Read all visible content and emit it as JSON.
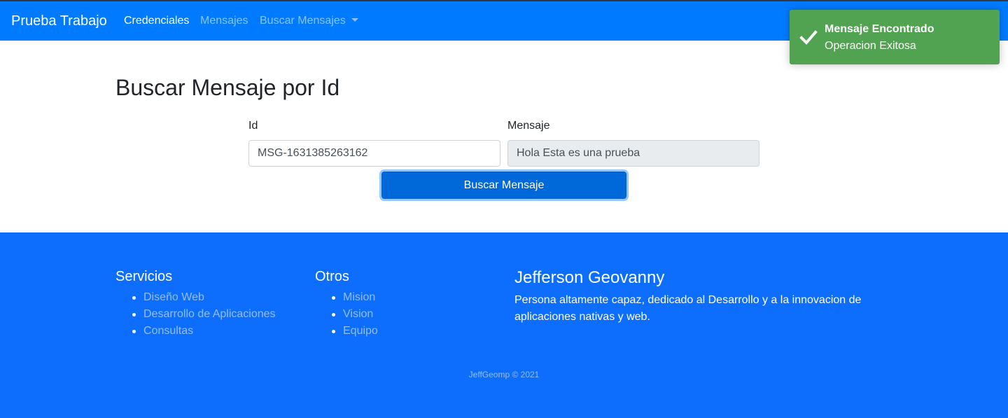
{
  "navbar": {
    "brand": "Prueba Trabajo",
    "links": [
      {
        "label": "Credenciales",
        "active": true
      },
      {
        "label": "Mensajes",
        "active": false
      },
      {
        "label": "Buscar Mensajes",
        "active": false,
        "dropdown": true
      }
    ],
    "color": "#007bff"
  },
  "toast": {
    "title": "Mensaje Encontrado",
    "message": "Operacion Exitosa",
    "icon": "check-icon",
    "color": "#51a351"
  },
  "main": {
    "title": "Buscar Mensaje por Id",
    "id_label": "Id",
    "id_value": "MSG-1631385263162",
    "message_label": "Mensaje",
    "message_value": "Hola Esta es una prueba",
    "button_label": "Buscar Mensaje"
  },
  "footer": {
    "services_title": "Servicios",
    "services": [
      "Diseño Web",
      "Desarrollo de Aplicaciones",
      "Consultas"
    ],
    "others_title": "Otros",
    "others": [
      "Mision",
      "Vision",
      "Equipo"
    ],
    "author_name": "Jefferson Geovanny",
    "author_desc": "Persona altamente capaz, dedicado al Desarrollo y a la innovacion de aplicaciones nativas y web.",
    "copyright": "JeffGeomp © 2021",
    "color": "#0d6efd"
  }
}
